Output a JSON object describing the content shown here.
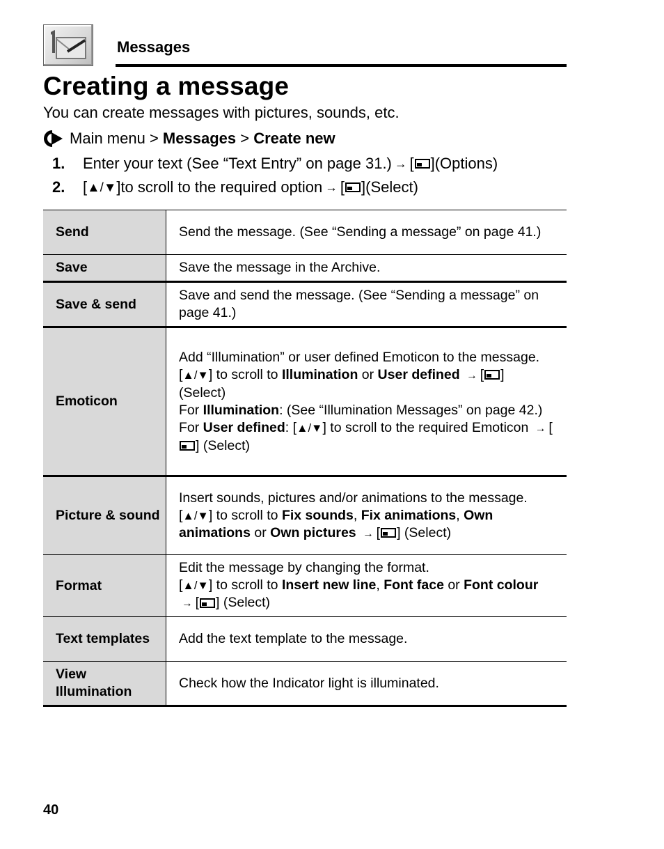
{
  "header": {
    "section_icon": "envelope-icon",
    "section_label": "Messages"
  },
  "title": "Creating a message",
  "intro": "You can create messages with pictures, sounds, etc.",
  "path": {
    "icon": "arrow-right-circle-icon",
    "prefix": "Main menu > ",
    "item1": "Messages",
    "sep": " > ",
    "item2": "Create new"
  },
  "steps": [
    {
      "num": "1.",
      "text_before": "Enter your text (See “Text Entry” on page 31.)",
      "arrow": "→",
      "key_icon": "softkey-icon",
      "text_after": " (Options)"
    },
    {
      "num": "2.",
      "updown": "▲/▼",
      "text_before": " to scroll to the required option",
      "arrow": "→",
      "key_icon": "softkey-icon",
      "text_after": " (Select)"
    }
  ],
  "table": {
    "rows": [
      {
        "label": "Send",
        "desc": "Send the message. (See “Sending a message” on page 41.)"
      },
      {
        "label": "Save",
        "desc": "Save the message in the Archive."
      },
      {
        "label": "Save & send",
        "desc": "Save and send the message. (See “Sending a message” on page 41.)"
      },
      {
        "label": "Emoticon",
        "desc1": "Add “Illumination” or user defined Emoticon to the message.",
        "desc2a": " to scroll to ",
        "b1": "Illumination",
        "desc2b": " or ",
        "b2": "User defined",
        "desc2c": " (Select)",
        "desc3a": "For ",
        "b3": "Illumination",
        "desc3b": ": (See “Illumination Messages” on page 42.)",
        "desc4a": "For ",
        "b4": "User defined",
        "desc4b": ": ",
        "desc4c": " to scroll to the required Emoticon ",
        "desc4d": " (Select)"
      },
      {
        "label": "Picture & sound",
        "desc1": "Insert sounds, pictures and/or animations to the message.",
        "desc2a": " to scroll to ",
        "b1": "Fix sounds",
        "sep1": ", ",
        "b2": "Fix animations",
        "sep2": ", ",
        "b3": "Own animations",
        "sep3": " or ",
        "b4": "Own pictures",
        "desc2b": " (Select)"
      },
      {
        "label": "Format",
        "desc1": "Edit the message by changing the format.",
        "desc2a": " to scroll to ",
        "b1": "Insert new line",
        "sep1": ", ",
        "b2": "Font face",
        "sep2": " or ",
        "b3": "Font colour",
        "desc2b": " (Select)"
      },
      {
        "label": "Text templates",
        "desc": "Add the text template to the message."
      },
      {
        "label": "View Illumination",
        "desc": "Check how the Indicator light is illuminated."
      }
    ],
    "updown": "▲/▼",
    "arrow": "→"
  },
  "page_number": "40"
}
